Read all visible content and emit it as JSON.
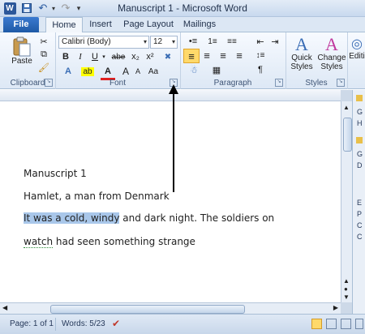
{
  "window": {
    "title": "Manuscript 1  -  Microsoft Word",
    "app_icon": "W"
  },
  "tabs": [
    {
      "label": "File"
    },
    {
      "label": "Home"
    },
    {
      "label": "Insert"
    },
    {
      "label": "Page Layout"
    },
    {
      "label": "Mailings"
    }
  ],
  "ribbon": {
    "clipboard": {
      "label": "Clipboard",
      "paste": "Paste"
    },
    "font": {
      "label": "Font",
      "font_name": "Calibri (Body)",
      "font_size": "12",
      "bold": "B",
      "italic": "I",
      "underline": "U",
      "strike": "abe",
      "subscript": "x₂",
      "superscript": "x²",
      "grow": "A",
      "shrink": "A",
      "case": "Aa"
    },
    "paragraph": {
      "label": "Paragraph"
    },
    "styles": {
      "label": "Styles",
      "quick": "Quick",
      "quick2": "Styles",
      "change": "Change",
      "change2": "Styles"
    },
    "editing": {
      "label": "Editi"
    }
  },
  "document": {
    "line1": "Manuscript 1",
    "line2": "Hamlet, a man from Denmark",
    "line3_selected": "It was a cold, windy",
    "line3_rest": " and dark night. The soldiers on",
    "line4_squiggle": "watch",
    "line4_rest": " had seen something strange"
  },
  "side_pane_letters": [
    "G",
    "H",
    "G",
    "D",
    "E",
    "P",
    "C",
    "C"
  ],
  "status": {
    "page": "Page: 1 of 1",
    "words": "Words: 5/23"
  },
  "colors": {
    "file_tab": "#2b579a",
    "selection": "#a9c7ea"
  }
}
